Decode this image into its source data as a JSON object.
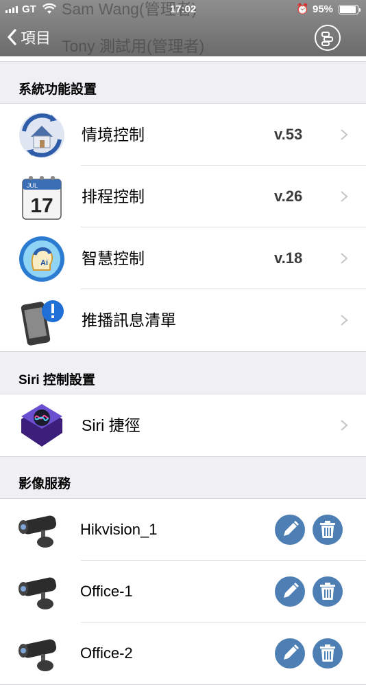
{
  "status_bar": {
    "carrier": "GT",
    "time": "17:02",
    "battery": "95%"
  },
  "ghost_text": {
    "line1": "Sam Wang(管理者)",
    "line2": "Tony 測試用(管理者)"
  },
  "nav": {
    "back_label": "項目"
  },
  "sections": [
    {
      "header": "系統功能設置",
      "items": [
        {
          "label": "情境控制",
          "version": "v.53",
          "icon": "scene-house-icon"
        },
        {
          "label": "排程控制",
          "version": "v.26",
          "icon": "calendar-icon"
        },
        {
          "label": "智慧控制",
          "version": "v.18",
          "icon": "ai-head-icon"
        },
        {
          "label": "推播訊息清單",
          "version": "",
          "icon": "phone-alert-icon"
        }
      ]
    },
    {
      "header": "Siri 控制設置",
      "items": [
        {
          "label": "Siri 捷徑",
          "icon": "siri-icon"
        }
      ]
    },
    {
      "header": "影像服務",
      "cameras": [
        {
          "name": "Hikvision_1"
        },
        {
          "name": "Office-1"
        },
        {
          "name": "Office-2"
        }
      ]
    }
  ],
  "colors": {
    "nav_bar": "#7a7a7a",
    "action_button": "#4e7fb4",
    "background": "#efeff4"
  }
}
